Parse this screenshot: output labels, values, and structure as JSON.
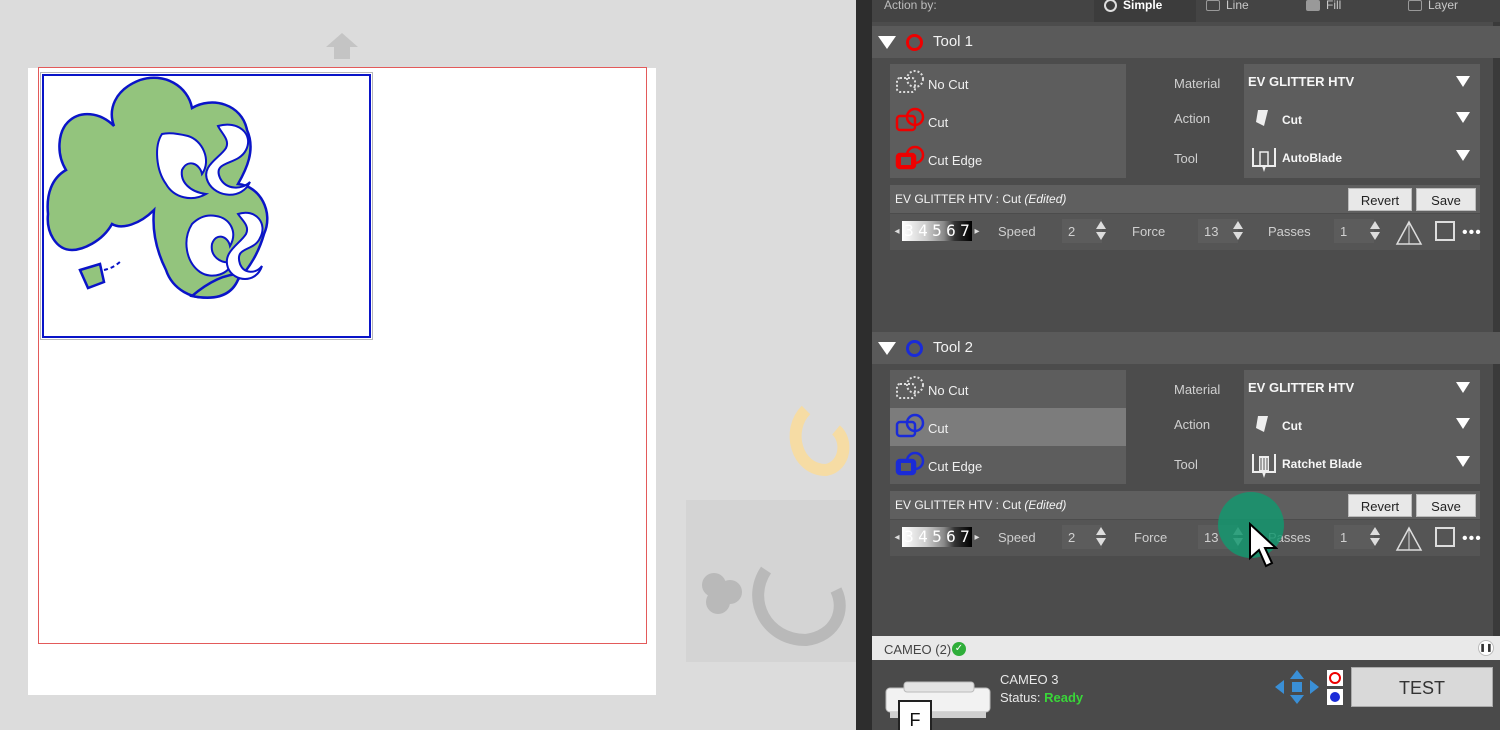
{
  "panel": {
    "action_by_label": "Action by:",
    "modes": [
      {
        "label": "Simple",
        "icon": "radio-icon",
        "active": true
      },
      {
        "label": "Line",
        "icon": "line-mode-icon",
        "active": false
      },
      {
        "label": "Fill",
        "icon": "fill-mode-icon",
        "active": false
      },
      {
        "label": "Layer",
        "icon": "layer-mode-icon",
        "active": false
      }
    ],
    "tools": [
      {
        "title": "Tool 1",
        "ring_color": "#e00000",
        "cut_options": [
          "No Cut",
          "Cut",
          "Cut Edge"
        ],
        "selected_option": null,
        "material_label": "Material",
        "material_value": "EV GLITTER HTV",
        "action_label": "Action",
        "action_value": "Cut",
        "tool_label": "Tool",
        "tool_value": "AutoBlade",
        "preset_name": "EV GLITTER HTV : Cut",
        "preset_edited": "(Edited)",
        "revert_label": "Revert",
        "save_label": "Save",
        "blade_strip": [
          "3",
          "4",
          "5",
          "6",
          "7"
        ],
        "speed_label": "Speed",
        "speed_value": "2",
        "force_label": "Force",
        "force_value": "13",
        "passes_label": "Passes",
        "passes_value": "1"
      },
      {
        "title": "Tool 2",
        "ring_color": "#1a2bd8",
        "cut_options": [
          "No Cut",
          "Cut",
          "Cut Edge"
        ],
        "selected_option": "Cut",
        "material_label": "Material",
        "material_value": "EV GLITTER HTV",
        "action_label": "Action",
        "action_value": "Cut",
        "tool_label": "Tool",
        "tool_value": "Ratchet Blade",
        "preset_name": "EV GLITTER HTV : Cut",
        "preset_edited": "(Edited)",
        "revert_label": "Revert",
        "save_label": "Save",
        "blade_strip": [
          "3",
          "4",
          "5",
          "6",
          "7"
        ],
        "speed_label": "Speed",
        "speed_value": "2",
        "force_label": "Force",
        "force_value": "13",
        "passes_label": "Passes",
        "passes_value": "1"
      }
    ]
  },
  "device": {
    "tab_label": "CAMEO (2)",
    "model": "CAMEO 3",
    "status_prefix": "Status:",
    "status_value": "Ready",
    "test_label": "TEST",
    "badge_letter": "F"
  },
  "colors": {
    "tool1": "#e00000",
    "tool2": "#1a2bd8",
    "shamrock_fill": "#93c47d",
    "status_ready": "#39d639",
    "cursor_halo": "#14966e"
  }
}
